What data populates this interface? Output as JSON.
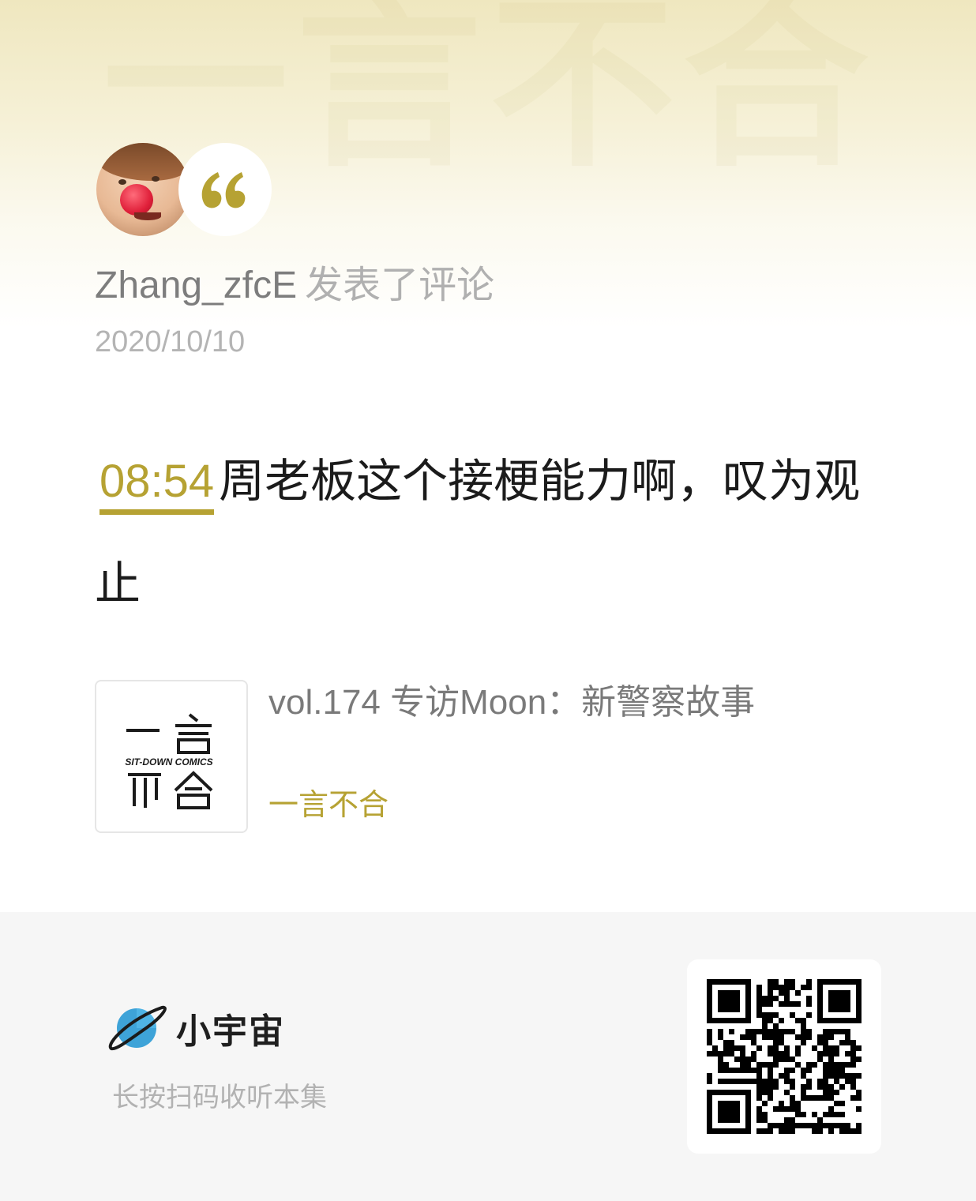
{
  "watermark": "一言不合",
  "comment_card": {
    "username": "Zhang_zfcE",
    "action": "发表了评论",
    "date": "2020/10/10",
    "timestamp": "08:54",
    "comment_text": "周老板这个接梗能力啊，叹为观止"
  },
  "episode": {
    "title": "vol.174 专访Moon：新警察故事",
    "channel": "一言不合",
    "cover": {
      "line1": "一言",
      "tagline": "SIT-DOWN COMICS",
      "line2": "不合"
    }
  },
  "footer": {
    "brand": "小宇宙",
    "hint": "长按扫码收听本集"
  },
  "colors": {
    "accent": "#b6a233",
    "brand_planet": "#3ea3d8"
  }
}
